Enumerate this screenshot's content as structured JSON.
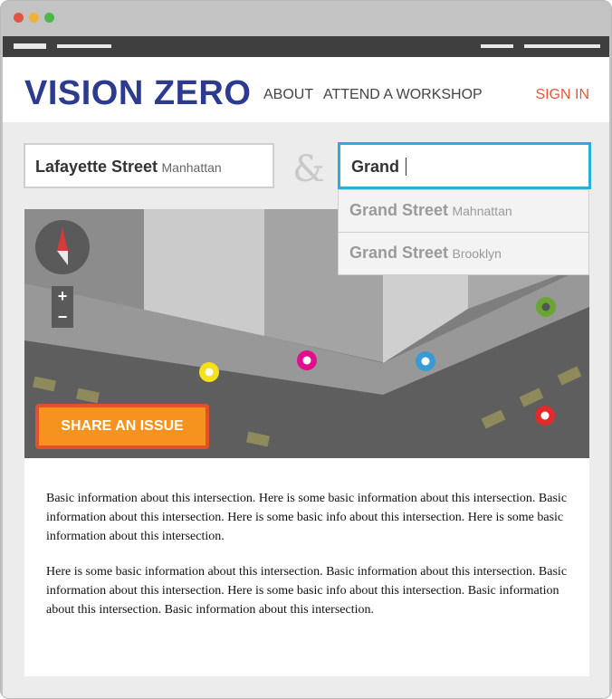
{
  "window": {
    "dots": [
      {
        "name": "close-dot",
        "color": "#e25543"
      },
      {
        "name": "minimize-dot",
        "color": "#f1b03a"
      },
      {
        "name": "maximize-dot",
        "color": "#4cb944"
      }
    ]
  },
  "header": {
    "brand": "VISION ZERO",
    "nav": [
      "ABOUT",
      "ATTEND A WORKSHOP"
    ],
    "signin": "SIGN IN",
    "colors": {
      "brand": "#2c3b8f",
      "signin": "#e5573a"
    }
  },
  "search": {
    "street1": {
      "name": "Lafayette Street",
      "borough": "Manhattan"
    },
    "ampersand": "&",
    "street2": {
      "value": "Grand"
    },
    "suggestions": [
      {
        "name": "Grand Street",
        "borough": "Mahnattan"
      },
      {
        "name": "Grand Street",
        "borough": "Brooklyn"
      }
    ]
  },
  "map": {
    "compass_icon": "compass-icon",
    "zoom": {
      "in": "+",
      "out": "−"
    },
    "markers": [
      {
        "name": "yellow-marker",
        "color": "#f4e11a"
      },
      {
        "name": "magenta-marker",
        "color": "#e10e8e"
      },
      {
        "name": "blue-marker",
        "color": "#3a9ad2"
      },
      {
        "name": "green-marker",
        "color": "#6aa534"
      },
      {
        "name": "red-marker",
        "color": "#e22a2a"
      }
    ],
    "share_button": "SHARE AN ISSUE",
    "accent": "#f5931e"
  },
  "content": {
    "paragraphs": [
      "Basic information about this intersection. Here is some basic information about this intersection. Basic information about this intersection. Here is some basic info about this intersection. Here is some basic information about this intersection.",
      "Here is some basic information about this intersection. Basic information about this intersection. Basic information about this intersection. Here is some basic info about this intersection. Basic information about this intersection. Basic information about this intersection."
    ]
  }
}
